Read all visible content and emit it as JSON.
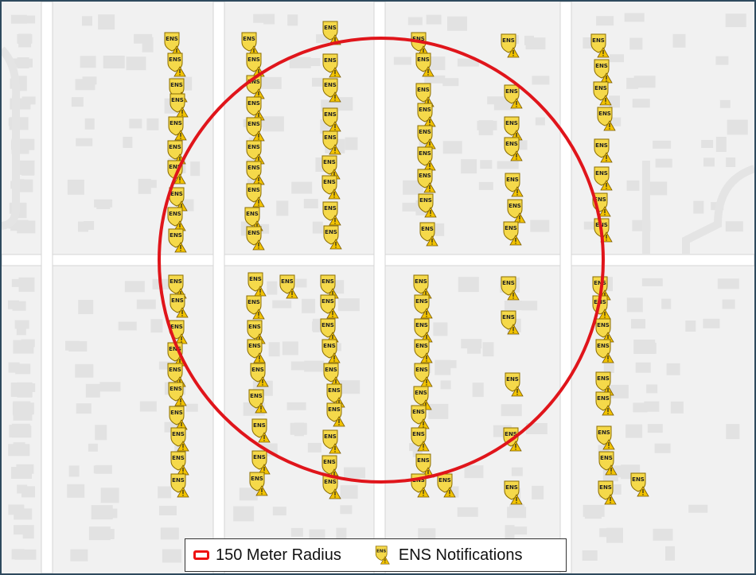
{
  "map": {
    "radius_color": "#e0151b",
    "marker_label": "ENS",
    "marker_shield_color": "#f5d94a",
    "marker_shield_stroke": "#8a6d00",
    "warning_color": "#f2c300",
    "road_color": "#ffffff",
    "block_color": "#f1f1f1",
    "building_color": "#e1e1e1"
  },
  "legend": {
    "radius_label": "150 Meter Radius",
    "notifications_label": "ENS Notifications",
    "notifications_icon": "ens-shield-warning-icon"
  }
}
